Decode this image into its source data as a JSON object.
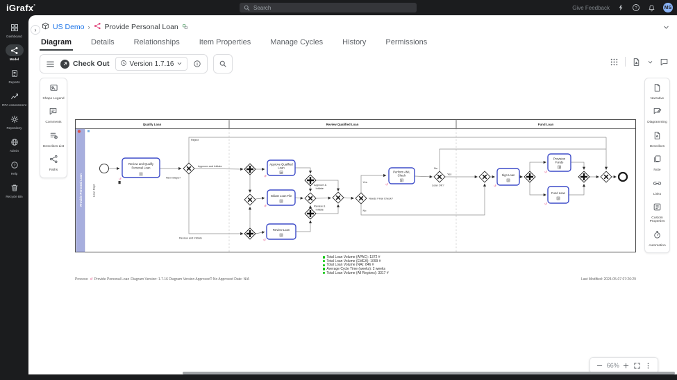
{
  "topbar": {
    "logo": "iGrafx",
    "search_placeholder": "Search",
    "give_feedback": "Give Feedback",
    "avatar_initials": "MS"
  },
  "sidebar": {
    "items": [
      {
        "label": "Dashboard"
      },
      {
        "label": "Model"
      },
      {
        "label": "Reports"
      },
      {
        "label": "RPA Assessment"
      },
      {
        "label": "Repository"
      },
      {
        "label": "Admin"
      },
      {
        "label": "Help"
      },
      {
        "label": "Recycle Bin"
      }
    ]
  },
  "breadcrumb": {
    "root": "US Demo",
    "separator": "›",
    "current": "Provide Personal Loan"
  },
  "tabs": [
    {
      "label": "Diagram"
    },
    {
      "label": "Details"
    },
    {
      "label": "Relationships"
    },
    {
      "label": "Item Properties"
    },
    {
      "label": "Manage Cycles"
    },
    {
      "label": "History"
    },
    {
      "label": "Permissions"
    }
  ],
  "toolbar": {
    "check_out_label": "Check Out",
    "version_label": "Version 1.7.16"
  },
  "left_panel": {
    "items": [
      {
        "label": "Shape Legend"
      },
      {
        "label": "Comments"
      },
      {
        "label": "Describes List"
      },
      {
        "label": "Paths"
      }
    ]
  },
  "right_panel": {
    "items": [
      {
        "label": "Narrative"
      },
      {
        "label": "Diagramming"
      },
      {
        "label": "Describes"
      },
      {
        "label": "Note"
      },
      {
        "label": "Links"
      },
      {
        "label": "Custom Properties"
      },
      {
        "label": "Automation"
      }
    ]
  },
  "diagram": {
    "phases": [
      {
        "label": "Qualify Loan"
      },
      {
        "label": "Review Qualified Loan"
      },
      {
        "label": "Fund Loan"
      }
    ],
    "pool_label": "Provide Personal Loan",
    "lane_label": "Loan Dept",
    "tasks": {
      "t1a": "Review and Qualify",
      "t1b": "Personal Loan",
      "t2a": "Approve Qualified",
      "t2b": "Loan",
      "t3": "Initiate Loan File",
      "t4": "Review Loan",
      "t5a": "Perform AML",
      "t5b": "Check",
      "t6": "Sign Loan",
      "t7a": "Provision",
      "t7b": "Funds",
      "t8": "Fund Loan"
    },
    "labels": {
      "next_steps": "Next Steps?",
      "reject": "Reject",
      "approve_and_initiate": "Approve and Initiate",
      "review_and_initiate": "Review and Initiate",
      "approve_amp_a": "Approve &",
      "approve_amp_b": "Initiate",
      "review_amp_a": "Review &",
      "review_amp_b": "Initiate",
      "needs_final_check": "Needs Final Check?",
      "yes1": "Yes",
      "no1": "No",
      "loan_ok": "Loan OK?",
      "yes2": "Yes",
      "no2": "No"
    }
  },
  "legend": {
    "dot_color": "#00c400",
    "items": [
      {
        "text": "Total Loan Volume (APAC): 1372 #"
      },
      {
        "text": "Total Loan Volume (EMEA): 1099 #"
      },
      {
        "text": "Total Loan Volume (NA): 846 #"
      },
      {
        "text": "Average Cycle Time (weeks): 2 weeks"
      },
      {
        "text": "Total Loan Volume (All Regions): 3317 #"
      }
    ]
  },
  "statusbar": {
    "prefix": "Process:",
    "process_name": "Provide Personal Loan",
    "details": "Diagram Version: 1.7.16 Diagram Version Approved? No Approved Date: N/A",
    "last_modified": "Last Modified: 2024-05-07 07:26:29"
  },
  "zoom_controls": {
    "level": "66%"
  },
  "colors": {
    "accent_link": "#1a73e8",
    "task_border": "#3d4bc8",
    "pool_fill": "#a7aede",
    "legend_green": "#00c400",
    "avatar_bg": "#8ab4f8",
    "share_icon": "#e0457b"
  }
}
